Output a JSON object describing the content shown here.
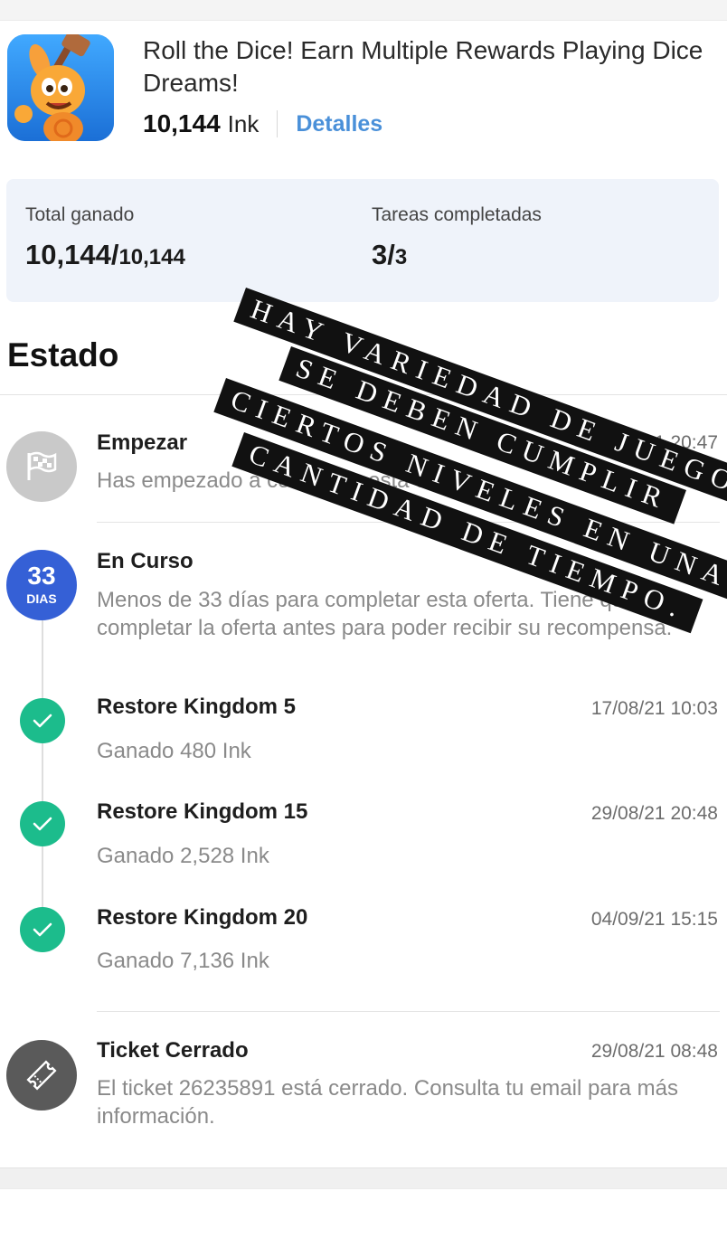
{
  "offer": {
    "title": "Roll the Dice! Earn Multiple Rewards Playing Dice Dreams!",
    "reward_value": "10,144",
    "reward_unit": "Ink",
    "details_label": "Detalles",
    "app_icon": "dice-dreams-app-icon"
  },
  "summary": {
    "total_label": "Total ganado",
    "total_earned": "10,144/",
    "total_max": "10,144",
    "tasks_label": "Tareas completadas",
    "tasks_done": "3/",
    "tasks_total": "3"
  },
  "status_heading": "Estado",
  "events": {
    "start": {
      "title": "Empezar",
      "date": "3/21 20:47",
      "desc": "Has empezado a completar esta oferta",
      "icon": "flag-icon"
    },
    "progress": {
      "badge_num": "33",
      "badge_unit": "DIAS",
      "title": "En Curso",
      "desc": "Menos de 33 días para completar esta oferta. Tiene que completar la oferta antes para poder recibir su recompensa."
    },
    "tasks": [
      {
        "title": "Restore Kingdom 5",
        "date": "17/08/21 10:03",
        "desc": "Ganado 480 Ink"
      },
      {
        "title": "Restore Kingdom 15",
        "date": "29/08/21 20:48",
        "desc": "Ganado 2,528 Ink"
      },
      {
        "title": "Restore Kingdom 20",
        "date": "04/09/21 15:15",
        "desc": "Ganado 7,136 Ink"
      }
    ],
    "ticket": {
      "title": "Ticket Cerrado",
      "date": "29/08/21 08:48",
      "desc": "El ticket 26235891 está cerrado. Consulta tu email para más información.",
      "icon": "ticket-icon"
    }
  },
  "overlay_caption": {
    "line1": "HAY VARIEDAD DE JUEGOS,",
    "line2": "SE DEBEN CUMPLIR",
    "line3": "CIERTOS NIVELES EN UNA",
    "line4": "CANTIDAD DE TIEMPO."
  },
  "colors": {
    "accent_link": "#4a90d9",
    "badge_blue": "#3560d6",
    "check_green": "#1cbc8c",
    "summary_bg": "#eff3fa",
    "grey_icon": "#c9c9c9",
    "dark_icon": "#5a5a5a"
  }
}
